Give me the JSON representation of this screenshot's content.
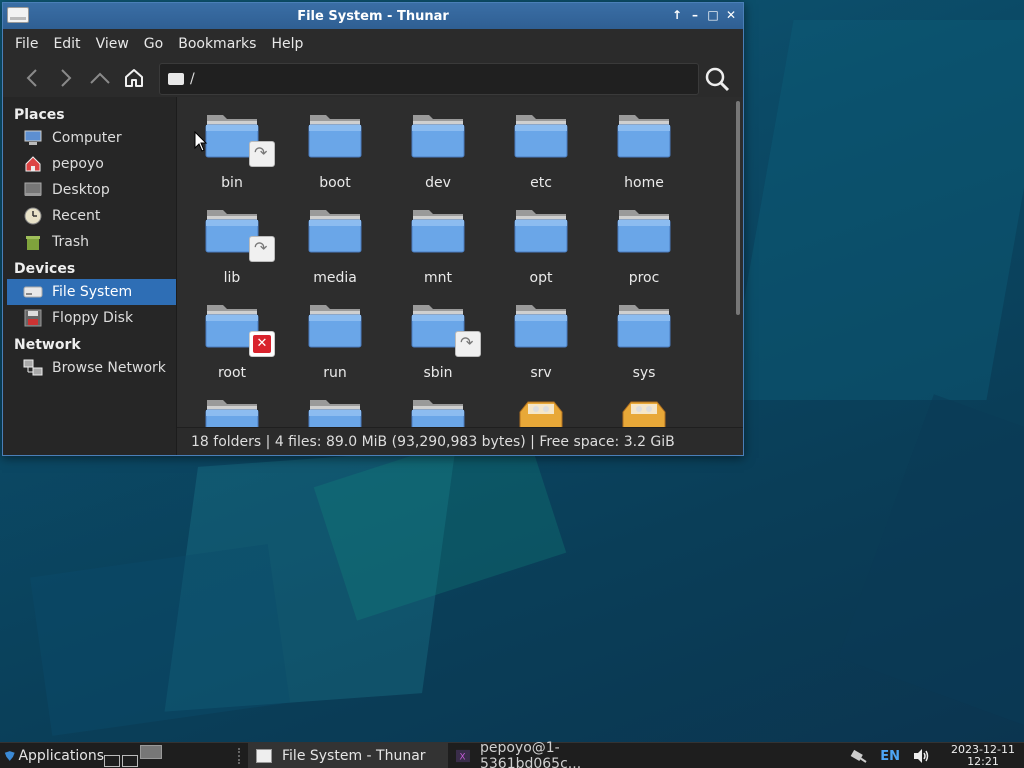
{
  "window": {
    "title": "File System - Thunar",
    "buttons": [
      "↑",
      "–",
      "□",
      "✕"
    ]
  },
  "menubar": [
    "File",
    "Edit",
    "View",
    "Go",
    "Bookmarks",
    "Help"
  ],
  "toolbar": {
    "location_path": "/"
  },
  "sidebar": {
    "sections": [
      {
        "heading": "Places",
        "items": [
          {
            "label": "Computer",
            "icon": "computer-icon"
          },
          {
            "label": "pepoyo",
            "icon": "home-icon"
          },
          {
            "label": "Desktop",
            "icon": "desktop-icon"
          },
          {
            "label": "Recent",
            "icon": "clock-icon"
          },
          {
            "label": "Trash",
            "icon": "trash-icon"
          }
        ]
      },
      {
        "heading": "Devices",
        "items": [
          {
            "label": "File System",
            "icon": "drive-icon",
            "selected": true
          },
          {
            "label": "Floppy Disk",
            "icon": "floppy-icon"
          }
        ]
      },
      {
        "heading": "Network",
        "items": [
          {
            "label": "Browse Network",
            "icon": "network-icon"
          }
        ]
      }
    ]
  },
  "files": [
    {
      "name": "bin",
      "type": "folder",
      "badge": "link"
    },
    {
      "name": "boot",
      "type": "folder"
    },
    {
      "name": "dev",
      "type": "folder"
    },
    {
      "name": "etc",
      "type": "folder"
    },
    {
      "name": "home",
      "type": "folder"
    },
    {
      "name": "lib",
      "type": "folder",
      "badge": "link"
    },
    {
      "name": "media",
      "type": "folder"
    },
    {
      "name": "mnt",
      "type": "folder"
    },
    {
      "name": "opt",
      "type": "folder"
    },
    {
      "name": "proc",
      "type": "folder"
    },
    {
      "name": "root",
      "type": "folder",
      "badge": "noaccess"
    },
    {
      "name": "run",
      "type": "folder"
    },
    {
      "name": "sbin",
      "type": "folder",
      "badge": "link"
    },
    {
      "name": "srv",
      "type": "folder"
    },
    {
      "name": "sys",
      "type": "folder"
    },
    {
      "name": "",
      "type": "folder"
    },
    {
      "name": "",
      "type": "folder"
    },
    {
      "name": "",
      "type": "folder"
    },
    {
      "name": "",
      "type": "package"
    },
    {
      "name": "",
      "type": "package"
    }
  ],
  "statusbar": "18 folders  |  4 files: 89.0 MiB (93,290,983 bytes)  |  Free space: 3.2 GiB",
  "taskbar": {
    "applications_label": "Applications",
    "tasks": [
      {
        "label": "File System - Thunar",
        "active": true
      },
      {
        "label": "pepoyo@1-5361bd065c...",
        "active": false
      }
    ],
    "keyboard_layout": "EN",
    "date": "2023-12-11",
    "time": "12:21"
  },
  "colors": {
    "selection": "#2e6eb5",
    "titlebar": "#3a6ea5",
    "folder": "#6aa6e8"
  }
}
